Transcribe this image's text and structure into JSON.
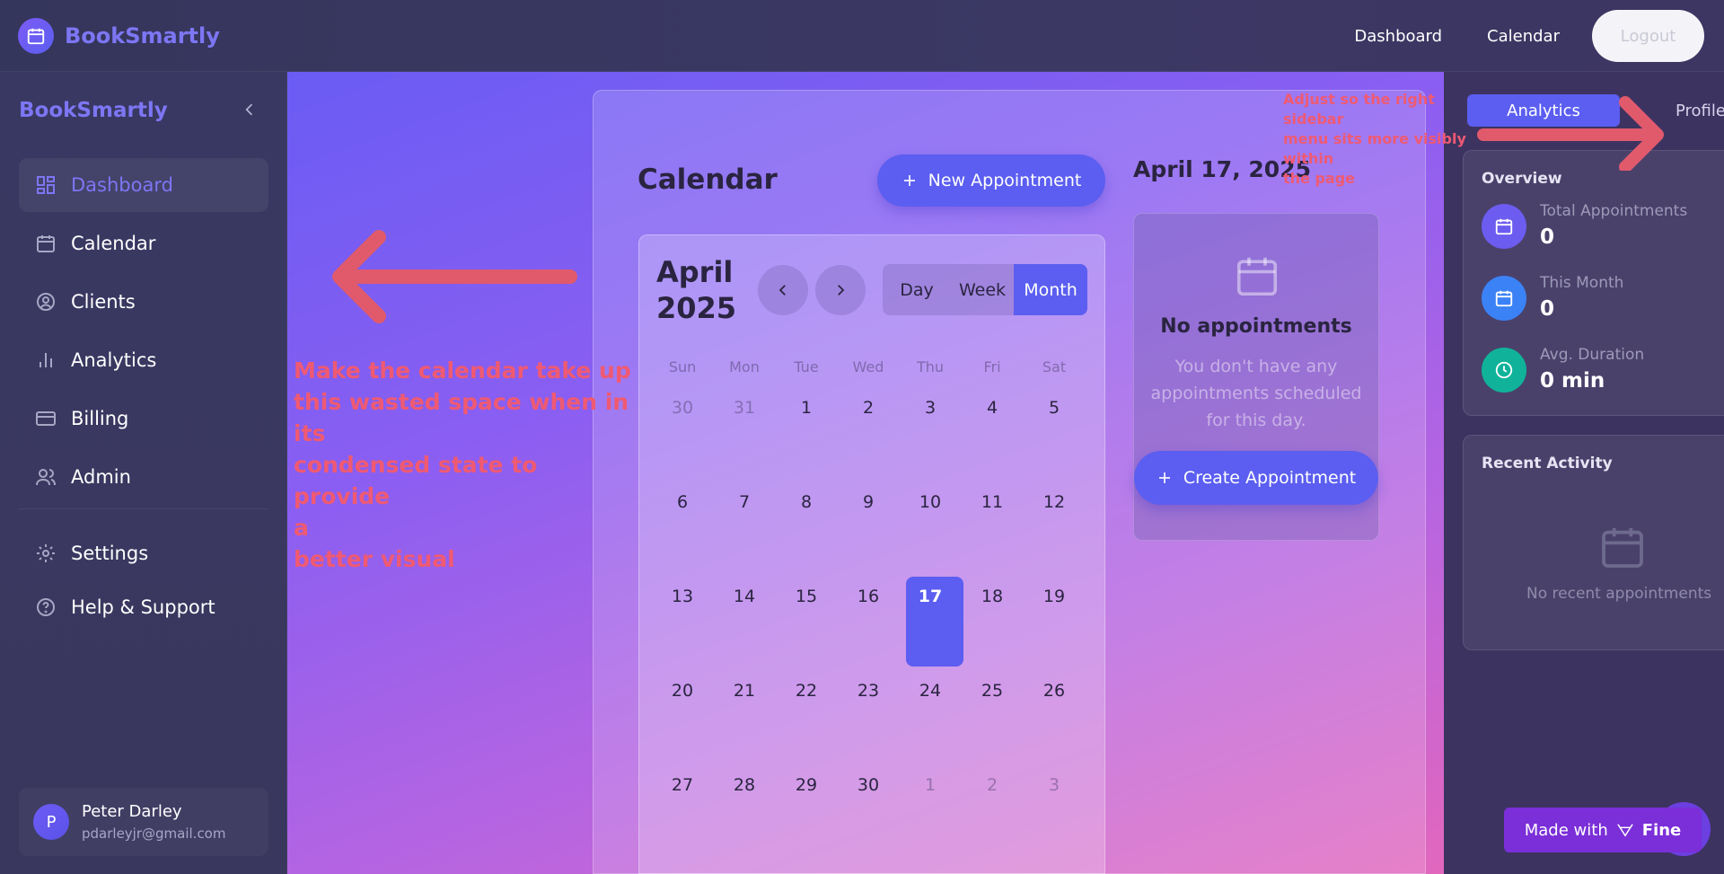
{
  "header": {
    "brand": "BookSmartly",
    "nav": [
      "Dashboard",
      "Calendar"
    ],
    "logout_label": "Logout"
  },
  "sidebar": {
    "brand": "BookSmartly",
    "items": [
      {
        "label": "Dashboard",
        "icon": "grid-icon",
        "active": true
      },
      {
        "label": "Calendar",
        "icon": "calendar-icon"
      },
      {
        "label": "Clients",
        "icon": "user-circle-icon"
      },
      {
        "label": "Analytics",
        "icon": "bar-chart-icon"
      },
      {
        "label": "Billing",
        "icon": "credit-card-icon"
      },
      {
        "label": "Admin",
        "icon": "users-icon"
      },
      {
        "label": "Settings",
        "icon": "gear-icon"
      },
      {
        "label": "Help & Support",
        "icon": "help-circle-icon"
      }
    ],
    "user": {
      "initial": "P",
      "name": "Peter Darley",
      "email": "pdarleyjr@gmail.com"
    }
  },
  "calendar": {
    "title": "Calendar",
    "new_appointment_label": "New Appointment",
    "month_label": "April 2025",
    "views": [
      "Day",
      "Week",
      "Month"
    ],
    "active_view": "Month",
    "weekdays": [
      "Sun",
      "Mon",
      "Tue",
      "Wed",
      "Thu",
      "Fri",
      "Sat"
    ],
    "weeks": [
      [
        "30",
        "31",
        "1",
        "2",
        "3",
        "4",
        "5"
      ],
      [
        "6",
        "7",
        "8",
        "9",
        "10",
        "11",
        "12"
      ],
      [
        "13",
        "14",
        "15",
        "16",
        "17",
        "18",
        "19"
      ],
      [
        "20",
        "21",
        "22",
        "23",
        "24",
        "25",
        "26"
      ],
      [
        "27",
        "28",
        "29",
        "30",
        "1",
        "2",
        "3"
      ]
    ],
    "selected_day": "17"
  },
  "day_panel": {
    "date_heading": "April 17, 2025",
    "empty_title": "No appointments",
    "empty_desc": "You don't have any appointments scheduled for this day.",
    "create_label": "Create Appointment"
  },
  "right_sidebar": {
    "tabs": [
      "Analytics",
      "Profile"
    ],
    "overview_title": "Overview",
    "stats": [
      {
        "label": "Total Appointments",
        "value": "0",
        "color": "#6c5cf0"
      },
      {
        "label": "This Month",
        "value": "0",
        "color": "#3b82f6"
      },
      {
        "label": "Avg. Duration",
        "value": "0 min",
        "color": "#10b39a"
      }
    ],
    "recent_title": "Recent Activity",
    "recent_empty": "No recent appointments"
  },
  "badge": {
    "made_with": "Made with",
    "brand": "Fine"
  },
  "annotations": {
    "left": "Make the calendar take up\nthis wasted space when in\nits\ncondensed state to provide\na\nbetter visual",
    "right": "Adjust so the right\nsidebar\nmenu sits more visibly\nwithin\nthe page"
  },
  "colors": {
    "accent": "#5b5ef0",
    "brand_text": "#7d76f4",
    "annotation": "#ef5a72"
  }
}
